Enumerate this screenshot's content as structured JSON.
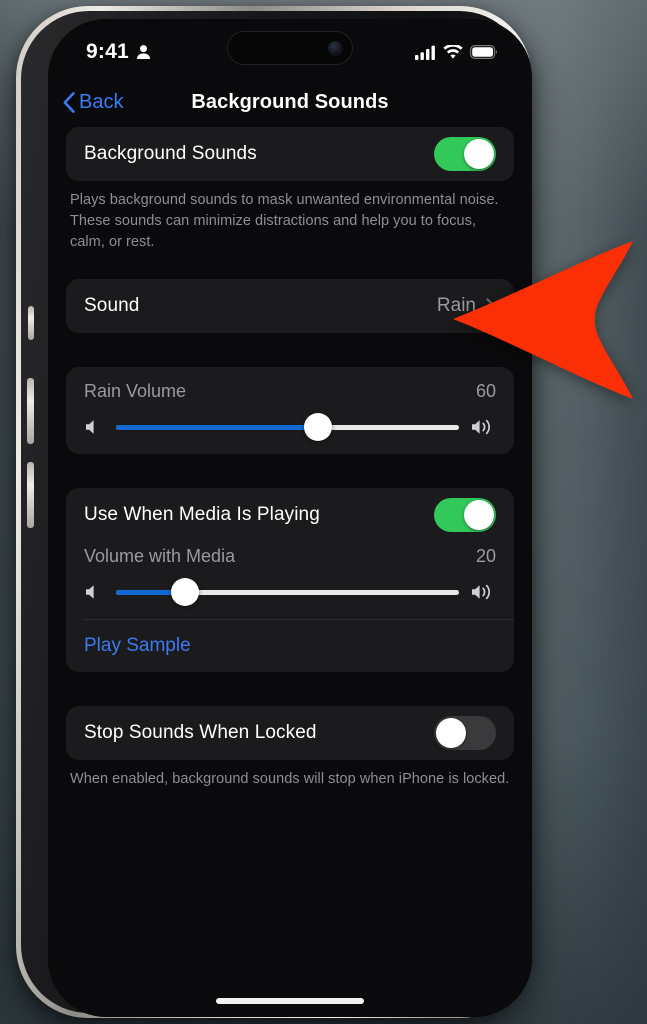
{
  "status_bar": {
    "time": "9:41",
    "person_icon": "person-icon",
    "cellular_icon": "cellular-signal-icon",
    "wifi_icon": "wifi-icon",
    "battery_icon": "battery-icon"
  },
  "nav": {
    "back_label": "Back",
    "back_icon": "chevron-left-icon",
    "title": "Background Sounds"
  },
  "sections": {
    "background_sounds": {
      "label": "Background Sounds",
      "toggle_state": "on",
      "footer": "Plays background sounds to mask unwanted environmental noise. These sounds can minimize distractions and help you to focus, calm, or rest."
    },
    "sound_row": {
      "label": "Sound",
      "value": "Rain",
      "chevron_icon": "chevron-right-icon"
    },
    "rain_volume": {
      "label": "Rain Volume",
      "value": "60",
      "percent": 59,
      "min_icon": "speaker-low-icon",
      "max_icon": "speaker-high-icon"
    },
    "use_when_media": {
      "label": "Use When Media Is Playing",
      "toggle_state": "on"
    },
    "volume_with_media": {
      "label": "Volume with Media",
      "value": "20",
      "percent": 20,
      "min_icon": "speaker-low-icon",
      "max_icon": "speaker-high-icon"
    },
    "play_sample": {
      "label": "Play Sample"
    },
    "stop_when_locked": {
      "label": "Stop Sounds When Locked",
      "toggle_state": "off",
      "footer": "When enabled, background sounds will stop when iPhone is locked."
    }
  },
  "annotation": {
    "arrow_icon": "red-arrow-left-icon",
    "color": "#fa2f05"
  },
  "colors": {
    "accent_blue": "#3b7bf0",
    "toggle_on_green": "#33c85a",
    "slider_fill_blue": "#1269d3",
    "card_bg": "#1b1b1d",
    "screen_bg": "#0a0a0c"
  }
}
